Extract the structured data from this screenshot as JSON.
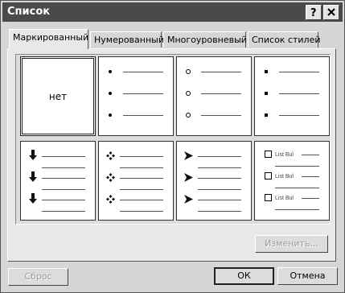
{
  "window": {
    "title": "Список"
  },
  "title_buttons": {
    "help": "?",
    "close": "✕"
  },
  "tabs": [
    {
      "label": "Маркированный",
      "active": true
    },
    {
      "label": "Нумерованный",
      "active": false
    },
    {
      "label": "Многоуровневый",
      "active": false
    },
    {
      "label": "Список стилей",
      "active": false
    }
  ],
  "bullet_styles": [
    {
      "id": "none",
      "label": "нет",
      "selected": true
    },
    {
      "id": "filled-circle",
      "marker": "filled-circle-icon"
    },
    {
      "id": "hollow-circle",
      "marker": "hollow-circle-icon"
    },
    {
      "id": "filled-square",
      "marker": "filled-square-icon"
    },
    {
      "id": "arrow-down",
      "marker": "arrow-down-icon"
    },
    {
      "id": "four-diamond",
      "marker": "four-diamond-icon"
    },
    {
      "id": "arrowhead",
      "marker": "arrowhead-icon"
    },
    {
      "id": "checkbox",
      "marker": "checkbox-icon",
      "sample_text": "List Bul"
    }
  ],
  "buttons": {
    "change": "Изменить...",
    "reset": "Сброс",
    "ok": "ОК",
    "cancel": "Отмена"
  }
}
